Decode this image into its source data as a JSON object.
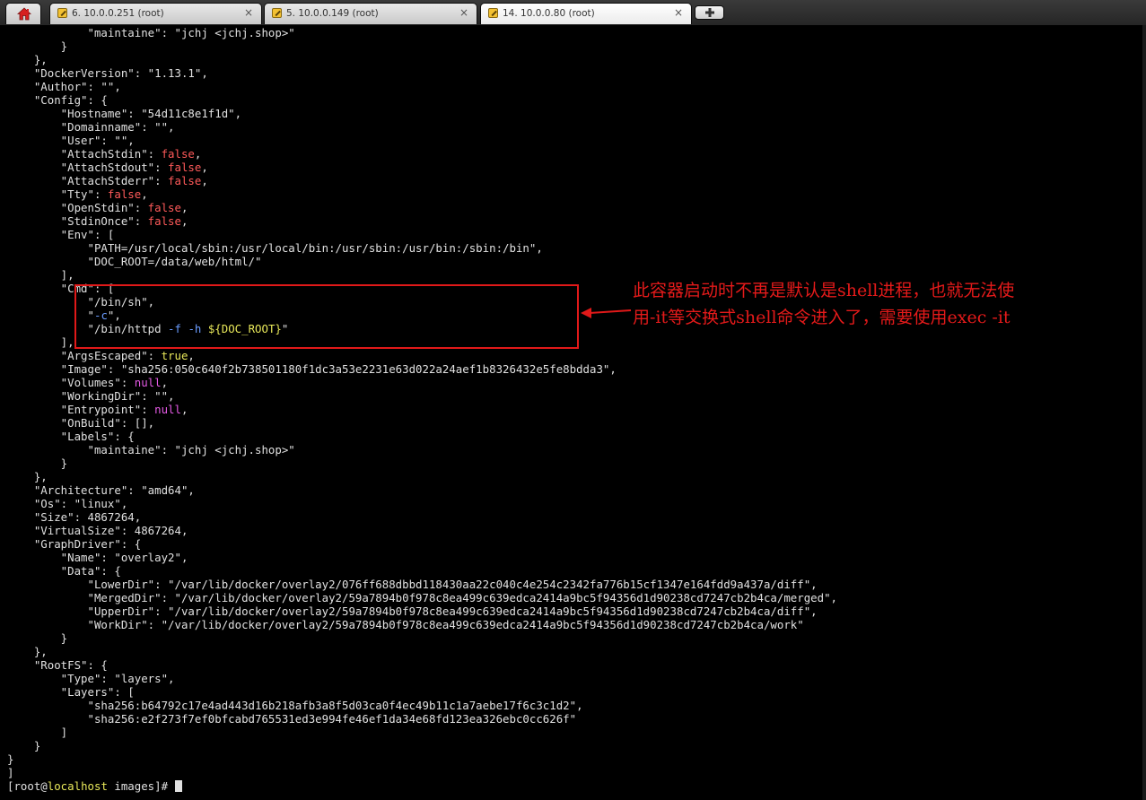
{
  "tabs": [
    {
      "label": "6. 10.0.0.251 (root)",
      "active": false
    },
    {
      "label": "5. 10.0.0.149 (root)",
      "active": false
    },
    {
      "label": "14. 10.0.0.80 (root)",
      "active": true
    }
  ],
  "icons": {
    "home": "home-icon",
    "tab": "putty-key-icon",
    "close": "close-icon",
    "new_tab": "plus-icon"
  },
  "close_glyph": "×",
  "colors": {
    "highlight_box": "#e11919",
    "note_text": "#e41a1a",
    "keyword_false": "#ff5a5a",
    "keyword_null": "#e65ae6"
  },
  "terminal": {
    "lines": [
      [
        {
          "t": "            \"maintaine\": \"jchj <jchj.shop>\""
        }
      ],
      [
        {
          "t": "        }"
        }
      ],
      [
        {
          "t": "    },"
        }
      ],
      [
        {
          "t": "    \"DockerVersion\": \"1.13.1\","
        }
      ],
      [
        {
          "t": "    \"Author\": \"\","
        }
      ],
      [
        {
          "t": "    \"Config\": {"
        }
      ],
      [
        {
          "t": "        \"Hostname\": \"54d11c8e1f1d\","
        }
      ],
      [
        {
          "t": "        \"Domainname\": \"\","
        }
      ],
      [
        {
          "t": "        \"User\": \"\","
        }
      ],
      [
        {
          "t": "        \"AttachStdin\": "
        },
        {
          "t": "false",
          "c": "kw"
        },
        {
          "t": ","
        }
      ],
      [
        {
          "t": "        \"AttachStdout\": "
        },
        {
          "t": "false",
          "c": "kw"
        },
        {
          "t": ","
        }
      ],
      [
        {
          "t": "        \"AttachStderr\": "
        },
        {
          "t": "false",
          "c": "kw"
        },
        {
          "t": ","
        }
      ],
      [
        {
          "t": "        \"Tty\": "
        },
        {
          "t": "false",
          "c": "kw"
        },
        {
          "t": ","
        }
      ],
      [
        {
          "t": "        \"OpenStdin\": "
        },
        {
          "t": "false",
          "c": "kw"
        },
        {
          "t": ","
        }
      ],
      [
        {
          "t": "        \"StdinOnce\": "
        },
        {
          "t": "false",
          "c": "kw"
        },
        {
          "t": ","
        }
      ],
      [
        {
          "t": "        \"Env\": ["
        }
      ],
      [
        {
          "t": "            \"PATH=/usr/local/sbin:/usr/local/bin:/usr/sbin:/usr/bin:/sbin:/bin\","
        }
      ],
      [
        {
          "t": "            \"DOC_ROOT=/data/web/html/\""
        }
      ],
      [
        {
          "t": "        ],"
        }
      ],
      [
        {
          "t": "        \"Cmd\": ["
        }
      ],
      [
        {
          "t": "            \"/bin/sh\","
        }
      ],
      [
        {
          "t": "            \""
        },
        {
          "t": "-c",
          "c": "cm"
        },
        {
          "t": "\","
        }
      ],
      [
        {
          "t": "            \"/bin/httpd "
        },
        {
          "t": "-f",
          "c": "cm"
        },
        {
          "t": " "
        },
        {
          "t": "-h",
          "c": "cm"
        },
        {
          "t": " "
        },
        {
          "t": "${DOC_ROOT}",
          "c": "dg"
        },
        {
          "t": "\""
        }
      ],
      [
        {
          "t": "        ],"
        }
      ],
      [
        {
          "t": "        \"ArgsEscaped\": "
        },
        {
          "t": "true",
          "c": "dg"
        },
        {
          "t": ","
        }
      ],
      [
        {
          "t": "        \"Image\": \"sha256:050c640f2b738501180f1dc3a53e2231e63d022a24aef1b8326432e5fe8bdda3\","
        }
      ],
      [
        {
          "t": "        \"Volumes\": "
        },
        {
          "t": "null",
          "c": "nl"
        },
        {
          "t": ","
        }
      ],
      [
        {
          "t": "        \"WorkingDir\": \"\","
        }
      ],
      [
        {
          "t": "        \"Entrypoint\": "
        },
        {
          "t": "null",
          "c": "nl"
        },
        {
          "t": ","
        }
      ],
      [
        {
          "t": "        \"OnBuild\": [],"
        }
      ],
      [
        {
          "t": "        \"Labels\": {"
        }
      ],
      [
        {
          "t": "            \"maintaine\": \"jchj <jchj.shop>\""
        }
      ],
      [
        {
          "t": "        }"
        }
      ],
      [
        {
          "t": "    },"
        }
      ],
      [
        {
          "t": "    \"Architecture\": \"amd64\","
        }
      ],
      [
        {
          "t": "    \"Os\": \"linux\","
        }
      ],
      [
        {
          "t": "    \"Size\": 4867264,"
        }
      ],
      [
        {
          "t": "    \"VirtualSize\": 4867264,"
        }
      ],
      [
        {
          "t": "    \"GraphDriver\": {"
        }
      ],
      [
        {
          "t": "        \"Name\": \"overlay2\","
        }
      ],
      [
        {
          "t": "        \"Data\": {"
        }
      ],
      [
        {
          "t": "            \"LowerDir\": \"/var/lib/docker/overlay2/076ff688dbbd118430aa22c040c4e254c2342fa776b15cf1347e164fdd9a437a/diff\","
        }
      ],
      [
        {
          "t": "            \"MergedDir\": \"/var/lib/docker/overlay2/59a7894b0f978c8ea499c639edca2414a9bc5f94356d1d90238cd7247cb2b4ca/merged\","
        }
      ],
      [
        {
          "t": "            \"UpperDir\": \"/var/lib/docker/overlay2/59a7894b0f978c8ea499c639edca2414a9bc5f94356d1d90238cd7247cb2b4ca/diff\","
        }
      ],
      [
        {
          "t": "            \"WorkDir\": \"/var/lib/docker/overlay2/59a7894b0f978c8ea499c639edca2414a9bc5f94356d1d90238cd7247cb2b4ca/work\""
        }
      ],
      [
        {
          "t": "        }"
        }
      ],
      [
        {
          "t": "    },"
        }
      ],
      [
        {
          "t": "    \"RootFS\": {"
        }
      ],
      [
        {
          "t": "        \"Type\": \"layers\","
        }
      ],
      [
        {
          "t": "        \"Layers\": ["
        }
      ],
      [
        {
          "t": "            \"sha256:b64792c17e4ad443d16b218afb3a8f5d03ca0f4ec49b11c1a7aebe17f6c3c1d2\","
        }
      ],
      [
        {
          "t": "            \"sha256:e2f273f7ef0bfcabd765531ed3e994fe46ef1da34e68fd123ea326ebc0cc626f\""
        }
      ],
      [
        {
          "t": "        ]"
        }
      ],
      [
        {
          "t": "    }"
        }
      ],
      [
        {
          "t": "}"
        }
      ],
      [
        {
          "t": "]"
        }
      ]
    ],
    "prompt": {
      "prefix": "[root@",
      "host": "localhost",
      "suffix": " images]# "
    }
  },
  "annotation": {
    "line1": "此容器启动时不再是默认是shell进程，也就无法使",
    "line2": "用-it等交换式shell命令进入了，需要使用exec -it"
  }
}
